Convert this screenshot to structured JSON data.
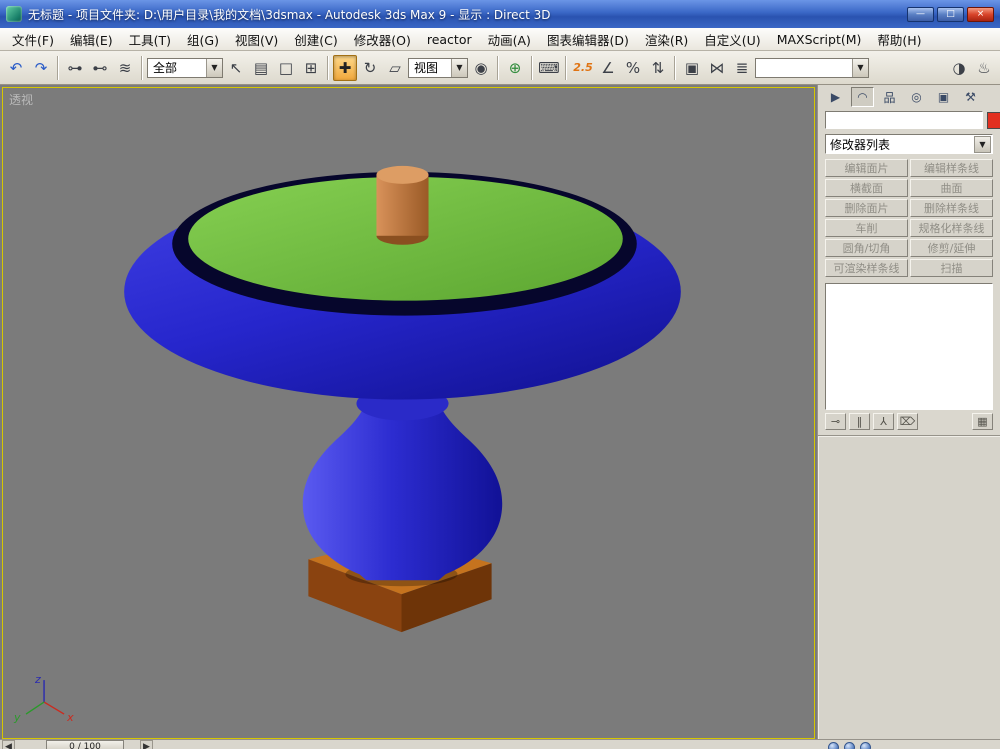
{
  "window": {
    "title": "无标题  - 项目文件夹: D:\\用户目录\\我的文档\\3dsmax  - Autodesk 3ds Max 9  - 显示 : Direct 3D",
    "controls": {
      "minimize": "—",
      "maximize": "□",
      "close": "×"
    }
  },
  "menubar": {
    "items": [
      "文件(F)",
      "编辑(E)",
      "工具(T)",
      "组(G)",
      "视图(V)",
      "创建(C)",
      "修改器(O)",
      "reactor",
      "动画(A)",
      "图表编辑器(D)",
      "渲染(R)",
      "自定义(U)",
      "MAXScript(M)",
      "帮助(H)"
    ]
  },
  "toolbar": {
    "selection_filter": "全部",
    "coordinate_system": "视图",
    "named_selection": "",
    "snap_value": "2.5",
    "icons": {
      "undo": "↶",
      "redo": "↷",
      "select_link": "⊶",
      "unlink": "⊷",
      "bind_spacewarp": "≋",
      "select": "↖",
      "select_by_name": "▤",
      "rect_region": "□",
      "crossing": "⊞",
      "move": "✚",
      "rotate": "↻",
      "scale": "▱",
      "pivot_center": "◉",
      "manipulate": "⊕",
      "keyboard_override": "⌨",
      "angle_snap": "∠",
      "percent_snap": "%",
      "spinner_snap": "⇅",
      "named_sets": "▣",
      "mirror": "⋈",
      "align": "≣",
      "material_editor": "◑",
      "render_scene": "♨",
      "dropdown_arrow": "▼"
    }
  },
  "viewport": {
    "label": "透视",
    "axes": {
      "x": "x",
      "y": "y",
      "z": "z"
    }
  },
  "panel": {
    "tab_icons": {
      "create": "▶",
      "modify": "◠",
      "hierarchy": "品",
      "motion": "◎",
      "display": "▣",
      "utilities": "⚒"
    },
    "object_name": "",
    "object_color": "#e23020",
    "modifier_list_label": "修改器列表",
    "dropdown_arrow": "▼",
    "modifier_buttons": [
      "编辑面片",
      "编辑样条线",
      "横截面",
      "曲面",
      "删除面片",
      "删除样条线",
      "车削",
      "规格化样条线",
      "圆角/切角",
      "修剪/延伸",
      "可渲染样条线",
      "扫描"
    ],
    "stack_icons": {
      "pin_stack": "⊸",
      "show_end_result": "‖",
      "make_unique": "⅄",
      "remove_modifier": "⌦",
      "configure_sets": "▦"
    }
  },
  "statusbar": {
    "time": "0 / 100",
    "prev": "◀",
    "next": "▶"
  },
  "colors": {
    "viewport_bg": "#7b7b7b",
    "active_border_yellow": "#d6c700",
    "table_blue": "#2a2ad2",
    "top_green": "#71bf3d",
    "ring_dark": "#06062c",
    "wood_orange": "#c5731e",
    "object_color_swatch": "#e23020"
  }
}
